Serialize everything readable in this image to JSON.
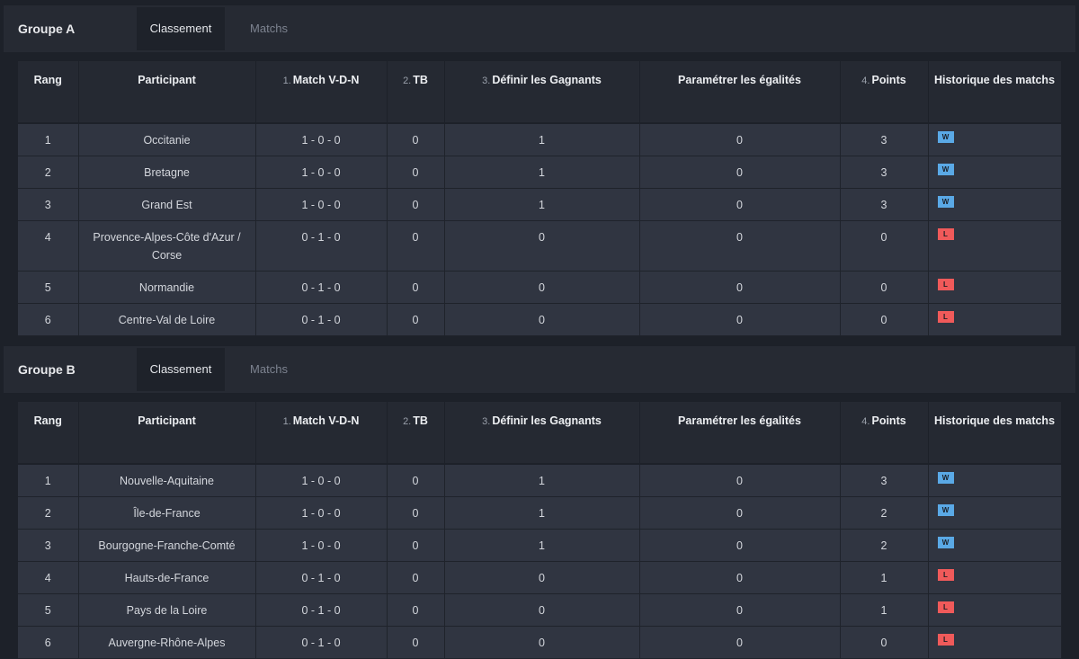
{
  "tabs": {
    "standings": "Classement",
    "matches": "Matchs"
  },
  "columns": [
    {
      "num": "",
      "label": "Rang"
    },
    {
      "num": "",
      "label": "Participant"
    },
    {
      "num": "1.",
      "label": "Match V-D-N"
    },
    {
      "num": "2.",
      "label": "TB"
    },
    {
      "num": "3.",
      "label": "Définir les Gagnants"
    },
    {
      "num": "",
      "label": "Paramétrer les égalités"
    },
    {
      "num": "4.",
      "label": "Points"
    },
    {
      "num": "",
      "label": "Historique des matchs"
    }
  ],
  "groups": [
    {
      "title": "Groupe A",
      "rows": [
        {
          "rank": "1",
          "participant": "Occitanie",
          "record": "1 - 0 - 0",
          "tb": "0",
          "winners": "1",
          "ties": "0",
          "points": "3",
          "history": "W"
        },
        {
          "rank": "2",
          "participant": "Bretagne",
          "record": "1 - 0 - 0",
          "tb": "0",
          "winners": "1",
          "ties": "0",
          "points": "3",
          "history": "W"
        },
        {
          "rank": "3",
          "participant": "Grand Est",
          "record": "1 - 0 - 0",
          "tb": "0",
          "winners": "1",
          "ties": "0",
          "points": "3",
          "history": "W"
        },
        {
          "rank": "4",
          "participant": "Provence-Alpes-Côte d'Azur / Corse",
          "record": "0 - 1 - 0",
          "tb": "0",
          "winners": "0",
          "ties": "0",
          "points": "0",
          "history": "L"
        },
        {
          "rank": "5",
          "participant": "Normandie",
          "record": "0 - 1 - 0",
          "tb": "0",
          "winners": "0",
          "ties": "0",
          "points": "0",
          "history": "L"
        },
        {
          "rank": "6",
          "participant": "Centre-Val de Loire",
          "record": "0 - 1 - 0",
          "tb": "0",
          "winners": "0",
          "ties": "0",
          "points": "0",
          "history": "L"
        }
      ]
    },
    {
      "title": "Groupe B",
      "rows": [
        {
          "rank": "1",
          "participant": "Nouvelle-Aquitaine",
          "record": "1 - 0 - 0",
          "tb": "0",
          "winners": "1",
          "ties": "0",
          "points": "3",
          "history": "W"
        },
        {
          "rank": "2",
          "participant": "Île-de-France",
          "record": "1 - 0 - 0",
          "tb": "0",
          "winners": "1",
          "ties": "0",
          "points": "2",
          "history": "W"
        },
        {
          "rank": "3",
          "participant": "Bourgogne-Franche-Comté",
          "record": "1 - 0 - 0",
          "tb": "0",
          "winners": "1",
          "ties": "0",
          "points": "2",
          "history": "W"
        },
        {
          "rank": "4",
          "participant": "Hauts-de-France",
          "record": "0 - 1 - 0",
          "tb": "0",
          "winners": "0",
          "ties": "0",
          "points": "1",
          "history": "L"
        },
        {
          "rank": "5",
          "participant": "Pays de la Loire",
          "record": "0 - 1 - 0",
          "tb": "0",
          "winners": "0",
          "ties": "0",
          "points": "1",
          "history": "L"
        },
        {
          "rank": "6",
          "participant": "Auvergne-Rhône-Alpes",
          "record": "0 - 1 - 0",
          "tb": "0",
          "winners": "0",
          "ties": "0",
          "points": "0",
          "history": "L"
        }
      ]
    }
  ],
  "colors": {
    "win": "#5aa9e6",
    "loss": "#f05a5a"
  }
}
